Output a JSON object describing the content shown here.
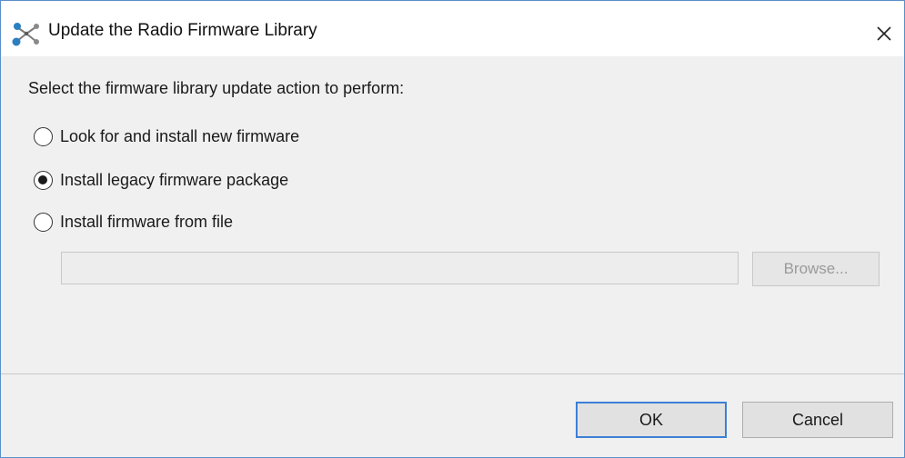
{
  "window": {
    "title": "Update the Radio Firmware Library",
    "icon": "network-nodes-icon",
    "close_symbol": "✕"
  },
  "dialog": {
    "prompt": "Select the firmware library update action to perform:",
    "options": [
      {
        "label": "Look for and install new firmware",
        "checked": false
      },
      {
        "label": "Install legacy firmware package",
        "checked": true
      },
      {
        "label": "Install firmware from file",
        "checked": false
      }
    ],
    "file_path": {
      "value": "",
      "placeholder": "",
      "enabled": false
    },
    "browse_label": "Browse...",
    "browse_enabled": false
  },
  "footer": {
    "ok_label": "OK",
    "cancel_label": "Cancel"
  },
  "colors": {
    "accent": "#3c7fd6",
    "window_border": "#5a8fc9",
    "dialog_bg": "#f0f0f0",
    "icon_blue": "#2a7fc0"
  }
}
